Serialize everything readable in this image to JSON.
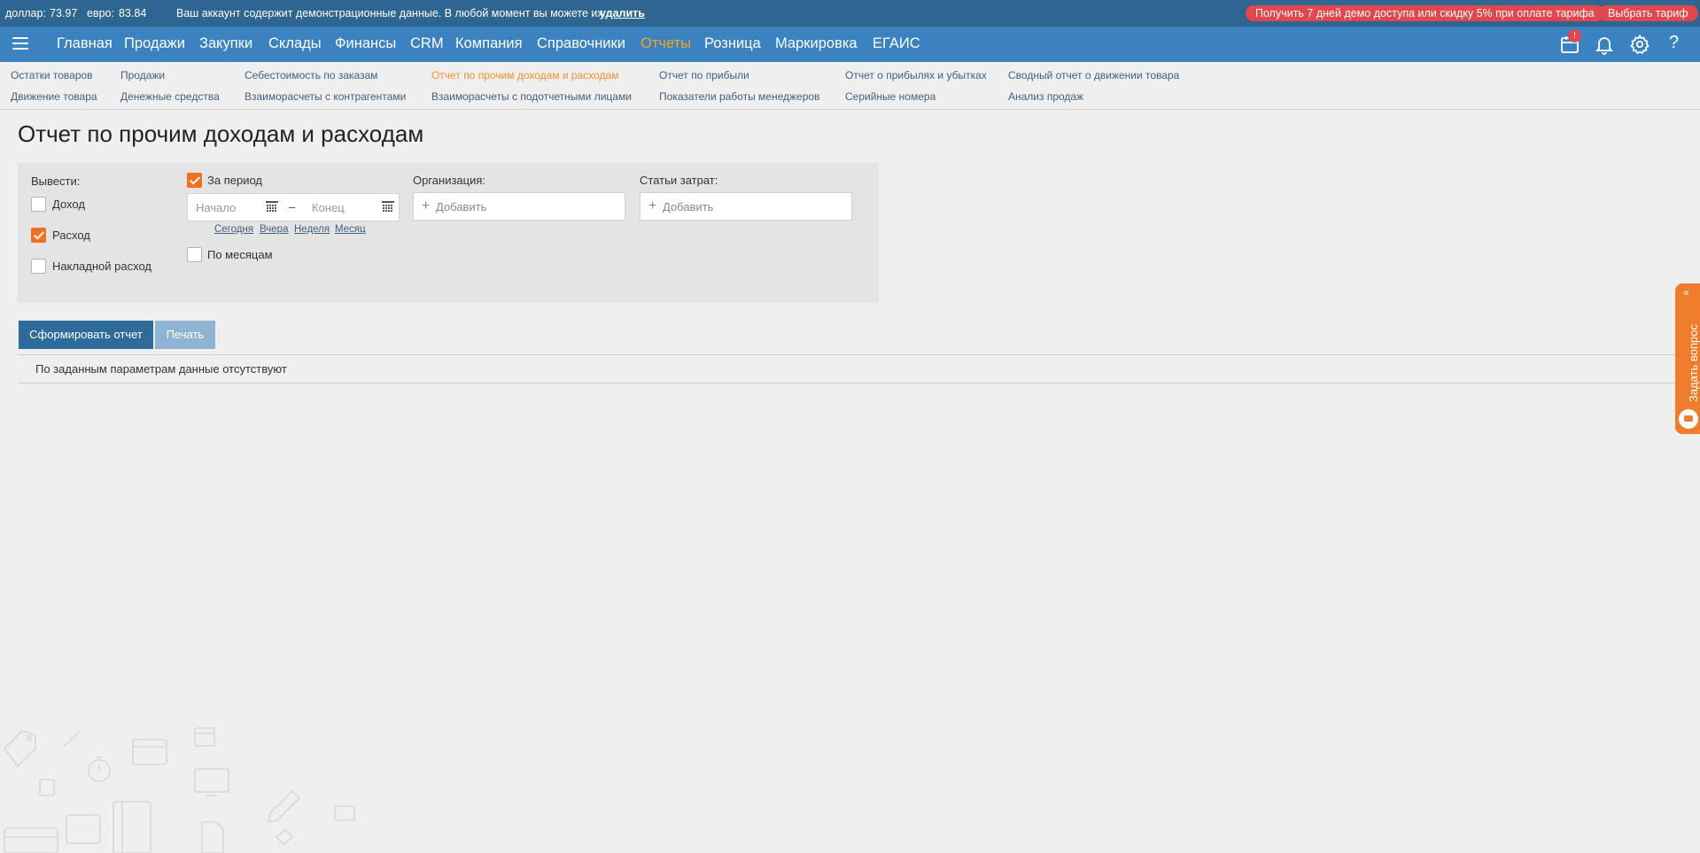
{
  "topbar": {
    "usd_label": "доллар:",
    "usd_value": "73.97",
    "eur_label": "евро:",
    "eur_value": "83.84",
    "demo_text": "Ваш аккаунт содержит демонстрационные данные. В любой момент вы можете их",
    "demo_delete": "удалить",
    "promo_button": "Получить 7 дней демо доступа или скидку 5% при оплате тарифа",
    "tariff_button": "Выбрать тариф",
    "colors": {
      "bar": "#2e6591",
      "pill": "#e2474d"
    }
  },
  "nav": {
    "items": [
      {
        "label": "Главная"
      },
      {
        "label": "Продажи"
      },
      {
        "label": "Закупки"
      },
      {
        "label": "Склады"
      },
      {
        "label": "Финансы"
      },
      {
        "label": "CRM"
      },
      {
        "label": "Компания"
      },
      {
        "label": "Справочники"
      },
      {
        "label": "Отчеты",
        "active": true
      },
      {
        "label": "Розница"
      },
      {
        "label": "Маркировка"
      },
      {
        "label": "ЕГАИС"
      }
    ],
    "badge": "!",
    "help": "?",
    "icons": [
      "menu-icon",
      "calendar-icon",
      "bell-icon",
      "gear-icon",
      "help-icon"
    ],
    "colors": {
      "bar": "#3b83c0",
      "active": "#f5a623"
    }
  },
  "subnav": {
    "links": [
      {
        "label": "Остатки товаров"
      },
      {
        "label": "Движение товара"
      },
      {
        "label": "Продажи"
      },
      {
        "label": "Денежные средства"
      },
      {
        "label": "Себестоимость по заказам"
      },
      {
        "label": "Взаиморасчеты с контрагентами"
      },
      {
        "label": "Отчет по прочим доходам и расходам",
        "active": true
      },
      {
        "label": "Взаиморасчеты с подотчетными лицами"
      },
      {
        "label": "Отчет по прибыли"
      },
      {
        "label": "Показатели работы менеджеров"
      },
      {
        "label": "Отчет о прибылях и убытках"
      },
      {
        "label": "Серийные номера"
      },
      {
        "label": "Сводный отчет о движении товара"
      },
      {
        "label": "Анализ продаж"
      }
    ]
  },
  "page": {
    "title": "Отчет по прочим доходам и расходам"
  },
  "filters": {
    "output_label": "Вывести:",
    "income_label": "Доход",
    "income_checked": false,
    "expense_label": "Расход",
    "expense_checked": true,
    "overhead_label": "Накладной расход",
    "overhead_checked": false,
    "period_label": "За период",
    "period_checked": true,
    "start_placeholder": "Начало",
    "start_value": "",
    "dash": "–",
    "end_placeholder": "Конец",
    "end_value": "",
    "quick": [
      "Сегодня",
      "Вчера",
      "Неделя",
      "Месяц"
    ],
    "by_months_label": "По месяцам",
    "by_months_checked": false,
    "org_label": "Организация:",
    "org_add": "Добавить",
    "expense_items_label": "Статьи затрат:",
    "expense_items_add": "Добавить",
    "colors": {
      "checked": "#f37021",
      "panel": "#e4e4e4"
    }
  },
  "actions": {
    "generate": "Сформировать отчет",
    "print": "Печать",
    "colors": {
      "primary": "#2f6b9a",
      "disabled": "#8fb3d2"
    }
  },
  "result": {
    "empty_text": "По заданным параметрам данные отсутствуют"
  },
  "side": {
    "ask_label": "Задать вопрос",
    "color": "#f07d2c"
  }
}
